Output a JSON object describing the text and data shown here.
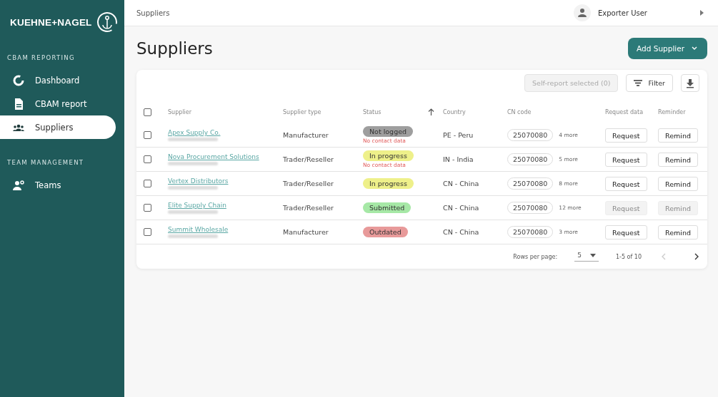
{
  "sidebar": {
    "logo": "KUEHNE+NAGEL",
    "sections": [
      {
        "title": "CBAM REPORTING",
        "items": [
          {
            "label": "Dashboard",
            "selected": false
          },
          {
            "label": "CBAM report",
            "selected": false
          },
          {
            "label": "Suppliers",
            "selected": true
          }
        ]
      },
      {
        "title": "TEAM MANAGEMENT",
        "items": [
          {
            "label": "Teams",
            "selected": false
          }
        ]
      }
    ]
  },
  "header": {
    "breadcrumb": "Suppliers",
    "user": "Exporter User"
  },
  "page": {
    "title": "Suppliers",
    "add_button": "Add Supplier"
  },
  "toolbar": {
    "self_report": {
      "label": "Self-report selected (0)",
      "disabled": true
    },
    "filter": "Filter"
  },
  "table": {
    "select_all_checked": false,
    "columns": [
      "Supplier",
      "Supplier type",
      "Status",
      "Country",
      "CN code",
      "Request data",
      "Reminder"
    ],
    "rows": [
      {
        "checked": false,
        "supplier": "Apex Supply Co.",
        "type": "Manufacturer",
        "status": {
          "label": "Not logged",
          "color": "#9e9e9e"
        },
        "warning": "No contact data",
        "country": "PE - Peru",
        "cn_code": "25070080",
        "more": "4 more",
        "request": {
          "label": "Request",
          "disabled": false
        },
        "remind": {
          "label": "Remind",
          "disabled": false
        }
      },
      {
        "checked": false,
        "supplier": "Nova Procurement Solutions",
        "type": "Trader/Reseller",
        "status": {
          "label": "In progress",
          "color": "#eef08a"
        },
        "warning": "No contact data",
        "country": "IN - India",
        "cn_code": "25070080",
        "more": "5 more",
        "request": {
          "label": "Request",
          "disabled": false
        },
        "remind": {
          "label": "Remind",
          "disabled": false
        }
      },
      {
        "checked": false,
        "supplier": "Vertex Distributors",
        "type": "Trader/Reseller",
        "status": {
          "label": "In progress",
          "color": "#eef08a"
        },
        "country": "CN - China",
        "cn_code": "25070080",
        "more": "8 more",
        "request": {
          "label": "Request",
          "disabled": false
        },
        "remind": {
          "label": "Remind",
          "disabled": false
        }
      },
      {
        "checked": false,
        "supplier": "Elite Supply Chain",
        "type": "Trader/Reseller",
        "status": {
          "label": "Submitted",
          "color": "#a6e8a6"
        },
        "country": "CN - China",
        "cn_code": "25070080",
        "more": "12 more",
        "request": {
          "label": "Request",
          "disabled": true
        },
        "remind": {
          "label": "Remind",
          "disabled": true
        }
      },
      {
        "checked": false,
        "supplier": "Summit Wholesale",
        "type": "Manufacturer",
        "status": {
          "label": "Outdated",
          "color": "#e89a9a"
        },
        "country": "CN - China",
        "cn_code": "25070080",
        "more": "3 more",
        "request": {
          "label": "Request",
          "disabled": false
        },
        "remind": {
          "label": "Remind",
          "disabled": false
        }
      }
    ]
  },
  "pagination": {
    "rows_label": "Rows per page:",
    "rows_value": "5",
    "range": "1-5 of 10",
    "prev_disabled": true,
    "next_disabled": false
  }
}
